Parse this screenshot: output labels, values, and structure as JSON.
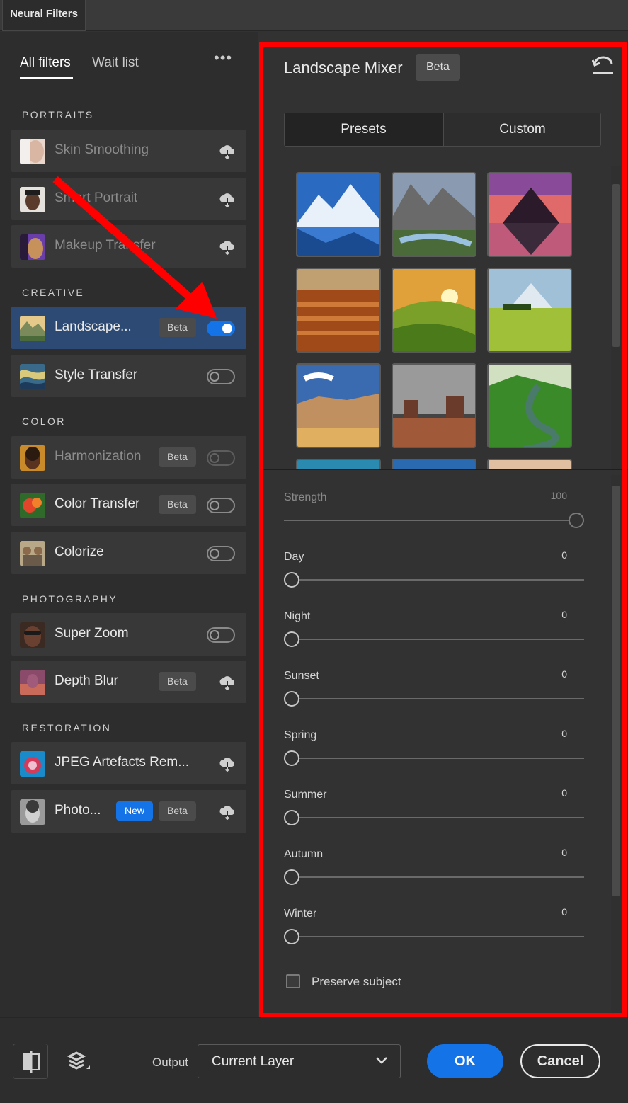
{
  "window": {
    "tab_title": "Neural Filters"
  },
  "left": {
    "tabs": [
      {
        "label": "All filters"
      },
      {
        "label": "Wait list"
      }
    ],
    "more_label": "•••",
    "sections": {
      "portraits": "PORTRAITS",
      "creative": "CREATIVE",
      "color": "COLOR",
      "photography": "PHOTOGRAPHY",
      "restoration": "RESTORATION"
    },
    "items": [
      {
        "label": "Skin Smoothing",
        "state": "cloud"
      },
      {
        "label": "Smart Portrait",
        "state": "cloud"
      },
      {
        "label": "Makeup Transfer",
        "state": "cloud"
      },
      {
        "label": "Landscape...",
        "badge": "Beta",
        "state": "on"
      },
      {
        "label": "Style Transfer",
        "state": "off"
      },
      {
        "label": "Harmonization",
        "badge": "Beta",
        "state": "off-disabled"
      },
      {
        "label": "Color Transfer",
        "badge": "Beta",
        "state": "off"
      },
      {
        "label": "Colorize",
        "state": "off"
      },
      {
        "label": "Super Zoom",
        "state": "off"
      },
      {
        "label": "Depth Blur",
        "badge": "Beta",
        "state": "cloud"
      },
      {
        "label": "JPEG Artefacts Rem...",
        "state": "cloud"
      },
      {
        "label": "Photo...",
        "badge_new": "New",
        "badge": "Beta",
        "state": "cloud"
      }
    ]
  },
  "right": {
    "title": "Landscape Mixer",
    "badge": "Beta",
    "segments": [
      {
        "label": "Presets"
      },
      {
        "label": "Custom"
      }
    ],
    "sliders": [
      {
        "label": "Strength",
        "value": "100",
        "fraction": 1.0
      },
      {
        "label": "Day",
        "value": "0",
        "fraction": 0
      },
      {
        "label": "Night",
        "value": "0",
        "fraction": 0
      },
      {
        "label": "Sunset",
        "value": "0",
        "fraction": 0
      },
      {
        "label": "Spring",
        "value": "0",
        "fraction": 0
      },
      {
        "label": "Summer",
        "value": "0",
        "fraction": 0
      },
      {
        "label": "Autumn",
        "value": "0",
        "fraction": 0
      },
      {
        "label": "Winter",
        "value": "0",
        "fraction": 0
      }
    ],
    "preserve_subject": {
      "label": "Preserve subject",
      "checked": false
    }
  },
  "bottom": {
    "output_label": "Output",
    "output_value": "Current Layer",
    "ok_label": "OK",
    "cancel_label": "Cancel"
  },
  "colors": {
    "accent": "#1473e6",
    "highlight": "#ff0000",
    "selected_item": "#2c4a73"
  }
}
